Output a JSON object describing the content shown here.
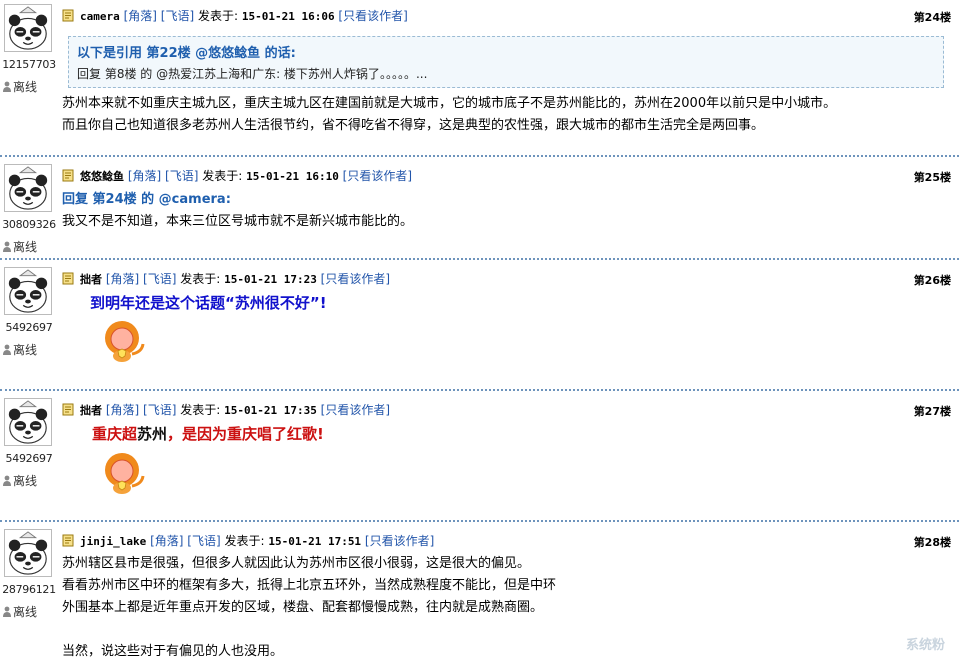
{
  "posts": [
    {
      "uid": "12157703",
      "status": "离线",
      "author": "camera",
      "tag1": "[角落]",
      "tag2": "[飞语]",
      "posted_label": "发表于:",
      "date": "15-01-21 16:06",
      "only_author": "[只看该作者]",
      "floor": "第24楼",
      "quote_head": "以下是引用 第22楼 @悠悠鲶鱼 的话:",
      "quote_body": "回复 第8楼 的 @热爱江苏上海和广东: 楼下苏州人炸锅了。。。。。...",
      "lines": [
        "苏州本来就不如重庆主城九区，重庆主城九区在建国前就是大城市，它的城市底子不是苏州能比的，苏州在2000年以前只是中小城市。",
        "而且你自己也知道很多老苏州人生活很节约，省不得吃省不得穿，这是典型的农性强，跟大城市的都市生活完全是两回事。"
      ]
    },
    {
      "uid": "30809326",
      "status": "离线",
      "author": "悠悠鲶鱼",
      "tag1": "[角落]",
      "tag2": "[飞语]",
      "posted_label": "发表于:",
      "date": "15-01-21 16:10",
      "only_author": "[只看该作者]",
      "floor": "第25楼",
      "reply_head": "回复 第24楼 的 @camera:",
      "lines": [
        "我又不是不知道，本来三位区号城市就不是新兴城市能比的。"
      ]
    },
    {
      "uid": "5492697",
      "status": "离线",
      "author": "拙者",
      "tag1": "[角落]",
      "tag2": "[飞语]",
      "posted_label": "发表于:",
      "date": "15-01-21 17:23",
      "only_author": "[只看该作者]",
      "floor": "第26楼",
      "big_text": "到明年还是这个话题“苏州很不好”!"
    },
    {
      "uid": "5492697",
      "status": "离线",
      "author": "拙者",
      "tag1": "[角落]",
      "tag2": "[飞语]",
      "posted_label": "发表于:",
      "date": "15-01-21 17:35",
      "only_author": "[只看该作者]",
      "floor": "第27楼",
      "big_text_a": "重庆超",
      "big_text_b": "苏州",
      "big_text_c": "，是因为重庆唱了红歌!"
    },
    {
      "uid": "28796121",
      "status": "离线",
      "author": "jinji_lake",
      "tag1": "[角落]",
      "tag2": "[飞语]",
      "posted_label": "发表于:",
      "date": "15-01-21 17:51",
      "only_author": "[只看该作者]",
      "floor": "第28楼",
      "lines": [
        "苏州辖区县市是很强，但很多人就因此认为苏州市区很小很弱，这是很大的偏见。",
        "看看苏州市区中环的框架有多大，抵得上北京五环外，当然成熟程度不能比，但是中环",
        "外围基本上都是近年重点开发的区域，楼盘、配套都慢慢成熟，往内就是成熟商圈。",
        "",
        "当然，说这些对于有偏见的人也没用。"
      ]
    }
  ],
  "watermark": "系统粉"
}
